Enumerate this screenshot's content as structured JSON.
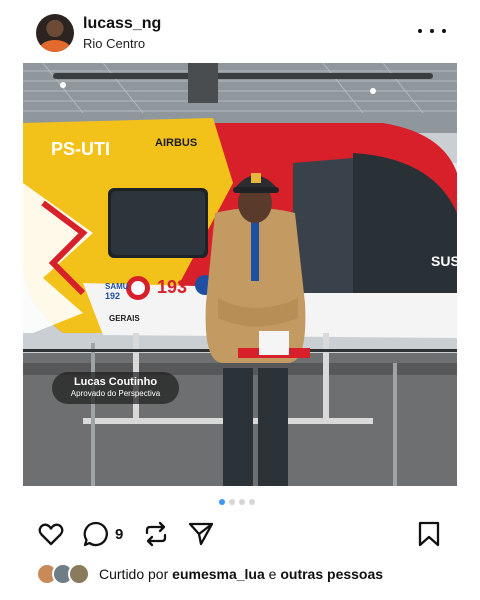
{
  "post": {
    "username": "lucass_ng",
    "location": "Rio Centro"
  },
  "photo": {
    "heli_text_reg": "PS-UTI",
    "heli_text_brand": "AIRBUS",
    "heli_text_samu": "SAMU",
    "heli_text_192": "192",
    "heli_text_193": "193",
    "heli_text_sus": "SUS",
    "heli_text_gerais": "GERAIS",
    "caption_name": "Lucas Coutinho",
    "caption_sub": "Aprovado do Perspectiva"
  },
  "carousel": {
    "total": 4,
    "active": 1
  },
  "actions": {
    "comment_count": "9"
  },
  "likes": {
    "prefix": "Curtido por",
    "user": "eumesma_lua",
    "connector": "e",
    "others": "outras pessoas"
  },
  "colors": {
    "accent": "#3897f0",
    "heli_red": "#d8202a",
    "heli_yellow": "#f2c21a"
  }
}
